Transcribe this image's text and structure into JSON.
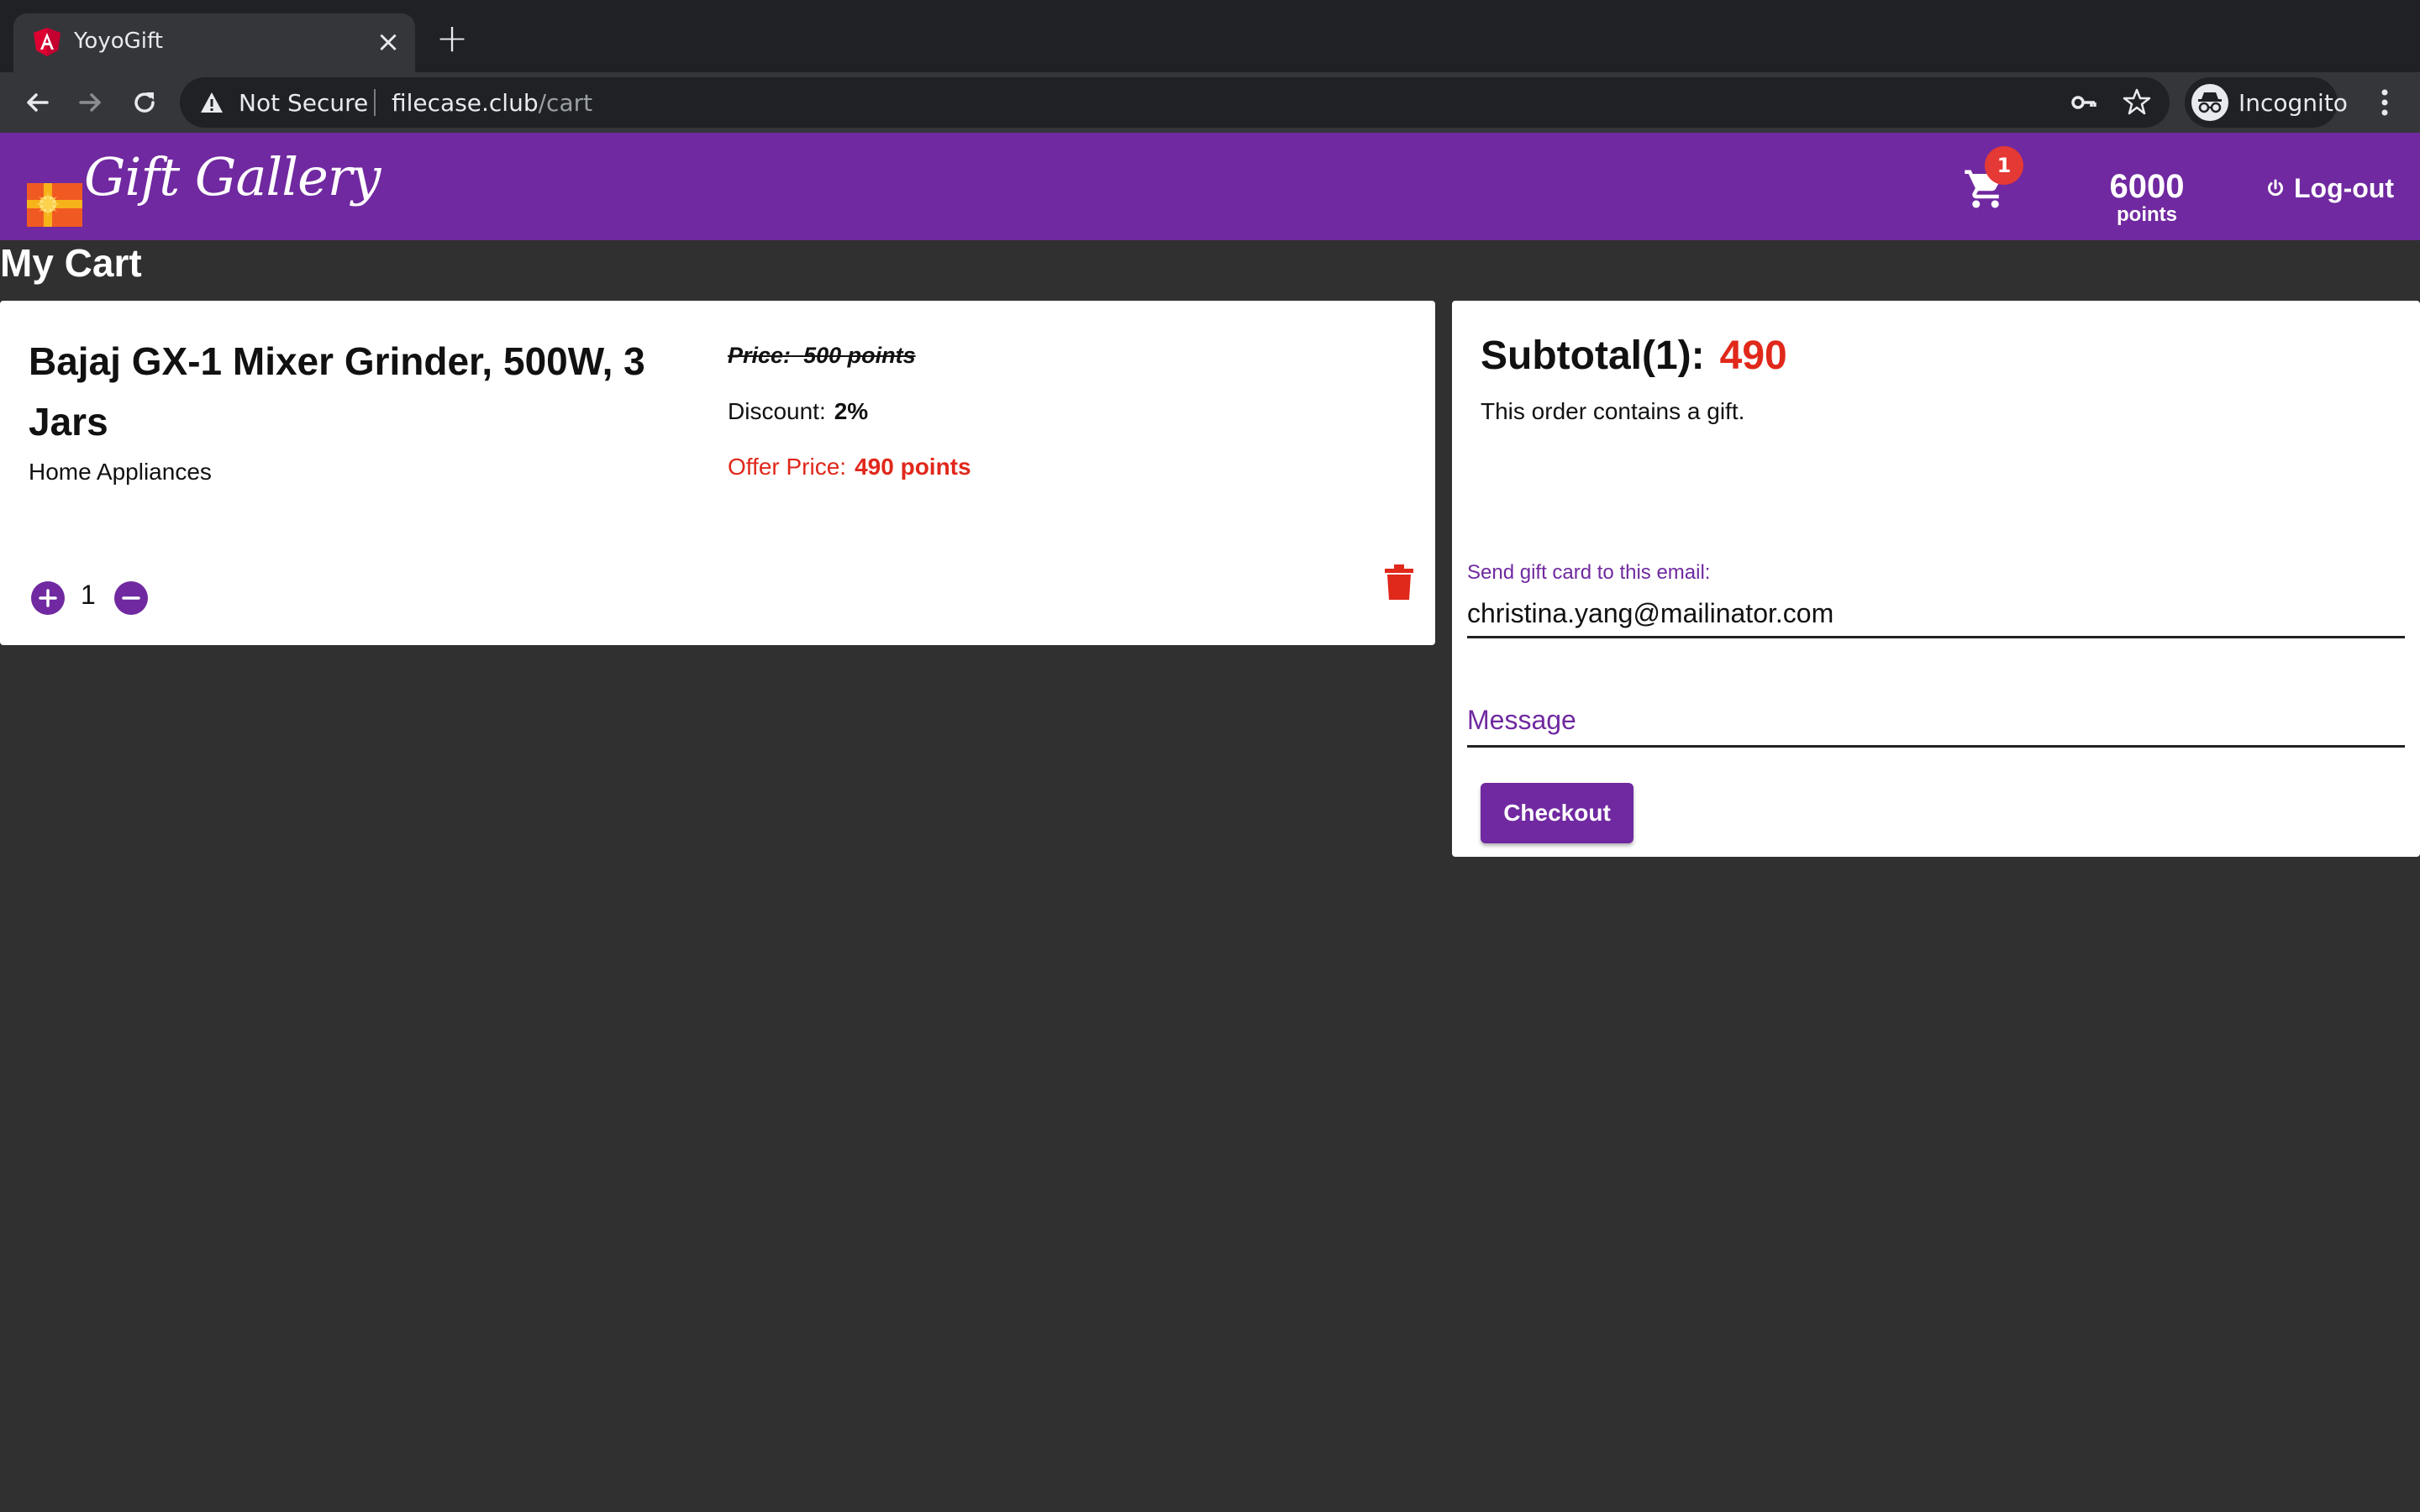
{
  "browser": {
    "tab_title": "YoyoGift",
    "security_label": "Not Secure",
    "url_host": "filecase.club",
    "url_path": "/cart",
    "profile_label": "Incognito"
  },
  "header": {
    "logo_text": "Gift Gallery",
    "cart_count": "1",
    "points_value": "6000",
    "points_label": "points",
    "logout_label": "Log-out"
  },
  "page": {
    "title": "My Cart"
  },
  "cart_item": {
    "name": "Bajaj GX-1 Mixer Grinder, 500W, 3 Jars",
    "category": "Home Appliances",
    "price_label": "Price:",
    "price_value": "500 points",
    "discount_label": "Discount:",
    "discount_value": "2%",
    "offer_label": "Offer Price:",
    "offer_value": "490 points",
    "quantity": "1"
  },
  "summary": {
    "subtotal_label": "Subtotal(1):",
    "subtotal_value": "490",
    "gift_note": "This order contains a gift.",
    "email_label": "Send gift card to this email:",
    "email_value": "christina.yang@mailinator.com",
    "message_placeholder": "Message",
    "checkout_label": "Checkout"
  },
  "colors": {
    "brand_purple": "#7029a0",
    "accent_red": "#e0281b",
    "page_background": "#303030"
  },
  "icons": [
    "angular-favicon-icon",
    "close-icon",
    "plus-icon",
    "back-arrow-icon",
    "forward-arrow-icon",
    "reload-icon",
    "warning-icon",
    "key-icon",
    "star-icon",
    "incognito-icon",
    "kebab-menu-icon",
    "gift-box-icon",
    "cart-icon",
    "power-icon",
    "add-circle-icon",
    "remove-circle-icon",
    "trash-icon"
  ]
}
